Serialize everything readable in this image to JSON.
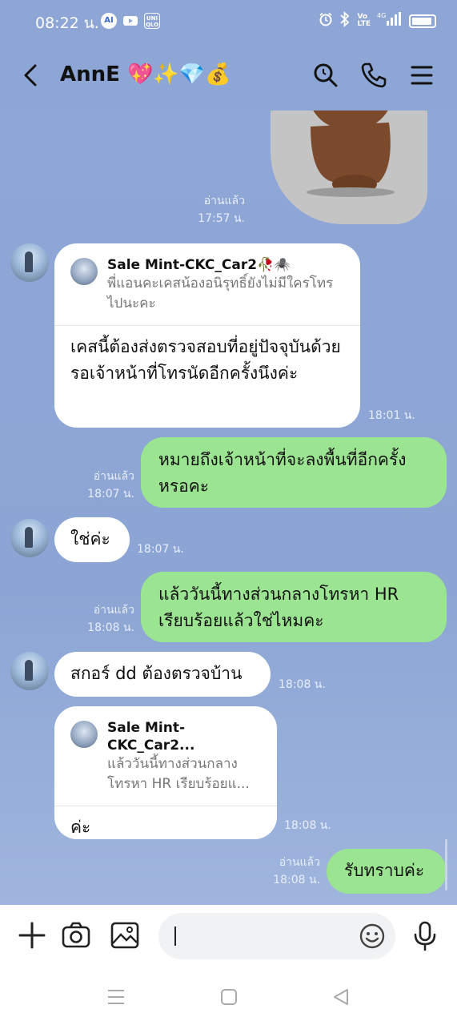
{
  "status_bar": {
    "time": "08:22 น.",
    "icons": [
      "ai-icon",
      "youtube-icon",
      "uniqlo-icon",
      "alarm-icon",
      "bluetooth-icon",
      "volte-icon",
      "signal-icon",
      "battery-icon"
    ],
    "uniqlo_text": "UNI QLO",
    "ai_text": "AI",
    "network": "4G"
  },
  "header": {
    "title": "AnnE 💖✨💎💰",
    "icons": [
      "back-icon",
      "search-icon",
      "phone-icon",
      "menu-icon"
    ]
  },
  "messages": [
    {
      "id": "m0",
      "type": "sticker",
      "side": "right",
      "read": "อ่านแล้ว",
      "time": "17:57 น."
    },
    {
      "id": "m1",
      "type": "reply",
      "side": "left",
      "reply_name": "Sale Mint-CKC_Car2🥀🕷️",
      "reply_text": "พี่แอนคะเคสน้องอนิรุทธิ์ยังไม่มีใครโทรไปนะคะ",
      "text": "เคสนี้ต้องส่งตรวจสอบที่อยู่ปัจจุบันด้วย รอเจ้าหน้าที่โทรนัดอีกครั้งนึงค่ะ",
      "time": "18:01 น."
    },
    {
      "id": "m2",
      "type": "text",
      "side": "right",
      "text": "หมายถึงเจ้าหน้าที่จะลงพื้นที่อีกครั้งหรอคะ",
      "read": "อ่านแล้ว",
      "time": "18:07 น."
    },
    {
      "id": "m3",
      "type": "text",
      "side": "left",
      "text": "ใช่ค่ะ",
      "time": "18:07 น."
    },
    {
      "id": "m4",
      "type": "text",
      "side": "right",
      "text": "แล้ววันนี้ทางส่วนกลางโทรหา HR เรียบร้อยแล้วใช่ไหมคะ",
      "read": "อ่านแล้ว",
      "time": "18:08 น."
    },
    {
      "id": "m5",
      "type": "text",
      "side": "left",
      "text": "สกอร์ dd ต้องตรวจบ้าน",
      "time": "18:08 น."
    },
    {
      "id": "m6",
      "type": "reply",
      "side": "left",
      "reply_name": "Sale Mint-CKC_Car2...",
      "reply_text": "แล้ววันนี้ทางส่วนกลางโทรหา HR เรียบร้อยแ...",
      "text": "ค่ะ",
      "time": "18:08 น."
    },
    {
      "id": "m7",
      "type": "text",
      "side": "right",
      "text": "รับทราบค่ะ",
      "read": "อ่านแล้ว",
      "time": "18:08 น."
    }
  ],
  "input_bar": {
    "placeholder": "",
    "icons": [
      "plus-icon",
      "camera-icon",
      "image-icon",
      "emoji-icon",
      "mic-icon"
    ]
  },
  "nav_bar": {
    "icons": [
      "recent-apps-icon",
      "home-icon",
      "back-nav-icon"
    ]
  }
}
